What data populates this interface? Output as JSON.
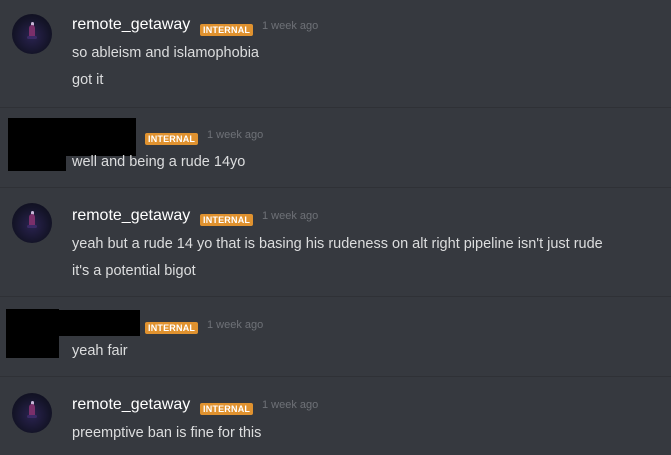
{
  "messages": [
    {
      "author": "remote_getaway",
      "badge": "INTERNAL",
      "timestamp": "1 week ago",
      "lines": [
        "so ableism and islamophobia",
        "got it"
      ]
    },
    {
      "author": "",
      "badge": "INTERNAL",
      "timestamp": "1 week ago",
      "lines": [
        "well and being a rude 14yo"
      ]
    },
    {
      "author": "remote_getaway",
      "badge": "INTERNAL",
      "timestamp": "1 week ago",
      "lines": [
        "yeah but a rude 14 yo that is basing his rudeness on alt right pipeline isn't just rude",
        "it's a potential bigot"
      ]
    },
    {
      "author": "",
      "badge": "INTERNAL",
      "timestamp": "1 week ago",
      "lines": [
        "yeah fair"
      ]
    },
    {
      "author": "remote_getaway",
      "badge": "INTERNAL",
      "timestamp": "1 week ago",
      "lines": [
        "preemptive ban is fine for this"
      ]
    }
  ],
  "colors": {
    "background": "#36393f",
    "badge": "#e0922f",
    "username": "#ffffff",
    "text": "#dcddde",
    "timestamp": "#6e7177"
  }
}
